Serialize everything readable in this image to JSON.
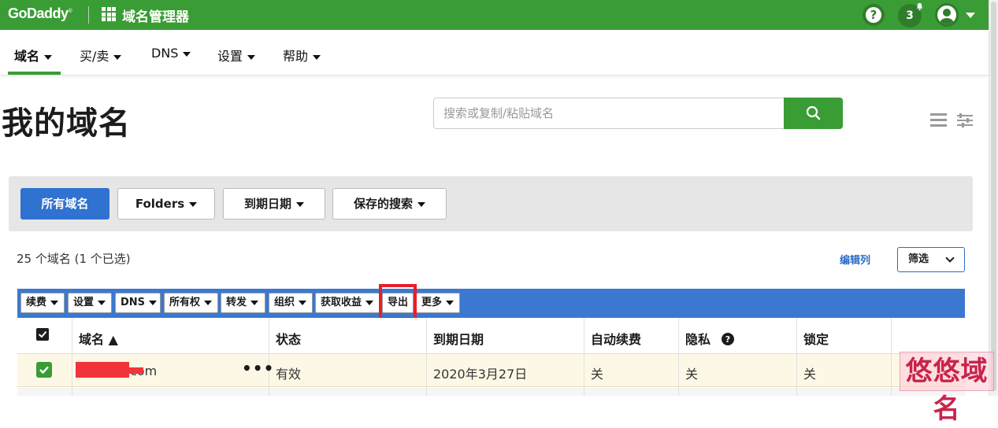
{
  "brand": {
    "logo": "GoDaddy",
    "app_title": "域名管理器",
    "primary": "#3a9c35",
    "accent": "#2f72d0"
  },
  "topbar": {
    "help_label": "?",
    "notifications_count": "3"
  },
  "nav": {
    "items": [
      {
        "label": "域名"
      },
      {
        "label": "买/卖"
      },
      {
        "label": "DNS"
      },
      {
        "label": "设置"
      },
      {
        "label": "帮助"
      }
    ]
  },
  "page": {
    "title": "我的域名"
  },
  "search": {
    "placeholder": "搜索或复制/粘贴域名"
  },
  "filters": {
    "all_domains": "所有域名",
    "folders": "Folders",
    "expiry": "到期日期",
    "saved": "保存的搜索"
  },
  "summary": {
    "count_text": "25 个域名   (1 个已选)",
    "edit_columns": "编辑列",
    "filter": "筛选"
  },
  "actions": {
    "items": [
      {
        "label": "续费"
      },
      {
        "label": "设置"
      },
      {
        "label": "DNS"
      },
      {
        "label": "所有权"
      },
      {
        "label": "转发"
      },
      {
        "label": "组织"
      },
      {
        "label": "获取收益"
      },
      {
        "label": "导出"
      },
      {
        "label": "更多"
      }
    ]
  },
  "table": {
    "headers": [
      "域名 ▲",
      "状态",
      "到期日期",
      "自动续费",
      "隐私",
      "锁定"
    ],
    "rows": [
      {
        "domain_suffix": ".com",
        "status": "有效",
        "expiry": "2020年3月27日",
        "auto_renew": "关",
        "privacy": "关",
        "lock": "关"
      }
    ]
  },
  "watermark": "悠悠域名"
}
